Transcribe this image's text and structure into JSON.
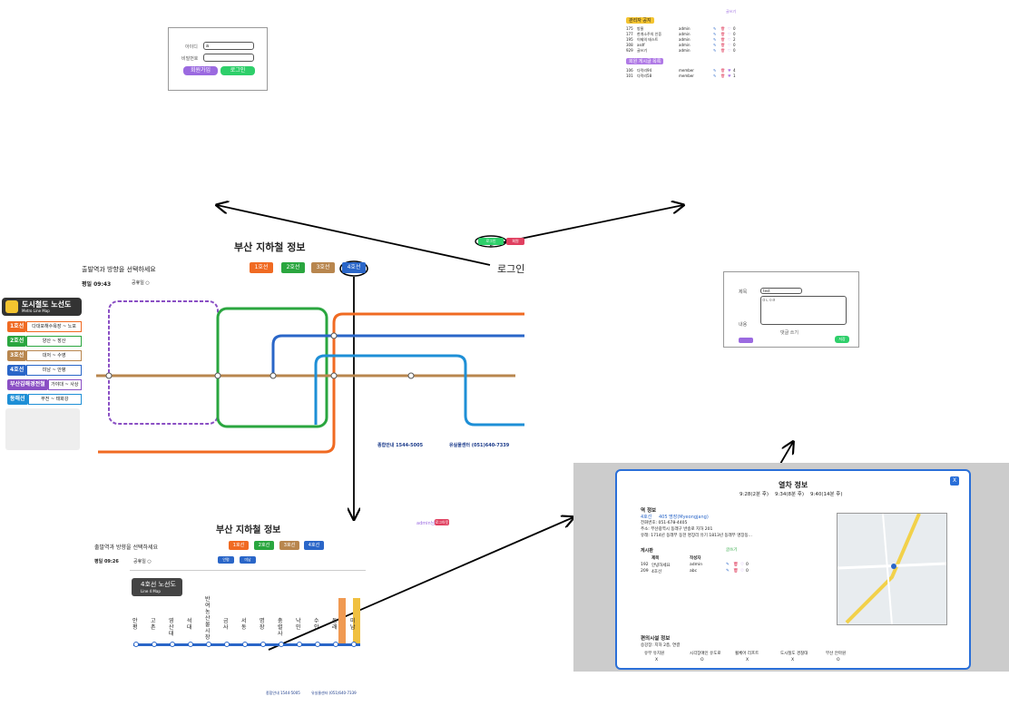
{
  "login_box": {
    "id_label": "아이디",
    "id_value": "a",
    "pw_label": "비밀번호",
    "btn_signup": "회원가입",
    "btn_login": "로그인"
  },
  "board_box": {
    "top_link": "글쓰기",
    "section_admin": "관리자 공지",
    "admin_rows": [
      {
        "id": "175",
        "title": "방울",
        "author": "admin",
        "likes": "0"
      },
      {
        "id": "177",
        "title": "한개소주의 인증",
        "author": "admin",
        "likes": "0"
      },
      {
        "id": "195",
        "title": "이제의 테스트",
        "author": "admin",
        "likes": "2"
      },
      {
        "id": "308",
        "title": "asdf",
        "author": "admin",
        "likes": "0"
      },
      {
        "id": "929",
        "title": "글쓰기",
        "author": "admin",
        "likes": "0"
      }
    ],
    "section_member": "회원 게시글 목록",
    "member_rows": [
      {
        "id": "106",
        "title": "다락리94",
        "author": "member",
        "likes": "4"
      },
      {
        "id": "101",
        "title": "다락리58",
        "author": "member",
        "likes": "1"
      }
    ]
  },
  "mini_login": {
    "btn1": "로그인",
    "btn2": "회원"
  },
  "login_arrow_label": "로그인",
  "main": {
    "title": "부산 지하철 정보",
    "subtitle": "출발역과 방향을 선택하세요",
    "lines": [
      "1호선",
      "2호선",
      "3호선",
      "4호선"
    ],
    "time_label": "평일 09:43",
    "holiday_label": "공휴일 ○"
  },
  "legend": {
    "header": "도시철도 노선도",
    "header_sub": "Metro Line Map",
    "rows": [
      {
        "tag": "1호선",
        "text": "다대포해수욕장 ~ 노포",
        "color": "#f06a22"
      },
      {
        "tag": "2호선",
        "text": "양산 ~ 장산",
        "color": "#2aa63f"
      },
      {
        "tag": "3호선",
        "text": "대저 ~ 수영",
        "color": "#b8864e"
      },
      {
        "tag": "4호선",
        "text": "미남 ~ 안평",
        "color": "#2a66c8"
      },
      {
        "tag": "부산김해경전철",
        "text": "가야대 ~ 사상",
        "color": "#8a4fc4"
      },
      {
        "tag": "동해선",
        "text": "부전 ~ 태화강",
        "color": "#1e8fd6"
      }
    ]
  },
  "map_footer": {
    "contact1": "종합안내 1544-5005",
    "contact2": "유실물센터 (051)640-7339"
  },
  "write_box": {
    "title_label": "제목",
    "title_value": "test",
    "content_label": "내용",
    "content_value": "ㅁㄴㅇㄹ",
    "toggle_text": "댓글 쓰기",
    "btn_save": "저장"
  },
  "line4": {
    "title": "부산 지하철 정보",
    "subtitle": "출발역과 방향을 선택하세요",
    "lines": [
      "1호선",
      "2호선",
      "3호선",
      "4호선"
    ],
    "time_label": "평일 09:26",
    "holiday_label": "공휴일 ○",
    "dir1": "안평",
    "dir2": "미남",
    "user_link": "admin님",
    "logout": "로그아웃",
    "map_title": "4호선 노선도",
    "map_sub": "Line 4 Map",
    "stations": [
      "안평",
      "고촌",
      "영산대",
      "석대",
      "반여농산물시장",
      "금사",
      "서동",
      "명장",
      "충렬사",
      "낙민",
      "수안",
      "동래",
      "미남"
    ]
  },
  "info": {
    "title": "열차 정보",
    "times": "9:28(2분 후)    9:34(8분 후)    9:40(14분 후)",
    "section_station": "역 정보",
    "line": "4호선",
    "station_name": "405 명장(Myeongjang)",
    "phone": "전화번호: 051-678-4405",
    "address": "주소: 부산광역시 동래구 반송로 지하 201",
    "desc": "유래: 1714년 동래부 동헌 명장리 유기 1813년 동래부 명장동...",
    "board_title": "게시판",
    "write_link": "글쓰기",
    "col_title": "제목",
    "col_author": "작성자",
    "rows": [
      {
        "id": "192",
        "title": "안녕하세요",
        "author": "admin",
        "likes": "0"
      },
      {
        "id": "209",
        "title": "4호선",
        "author": "abc",
        "likes": "0"
      }
    ],
    "facility_title": "편의시설 정보",
    "facility_sub": "승강장: 지하 2층, 연결",
    "facility_cols": [
      "유부 유치원",
      "시각장애인 유도로",
      "휠체어 리프트",
      "도시철도 경찰대",
      "부산 안마원"
    ],
    "facility_vals": [
      "X",
      "O",
      "X",
      "X",
      "O"
    ],
    "close": "X"
  }
}
